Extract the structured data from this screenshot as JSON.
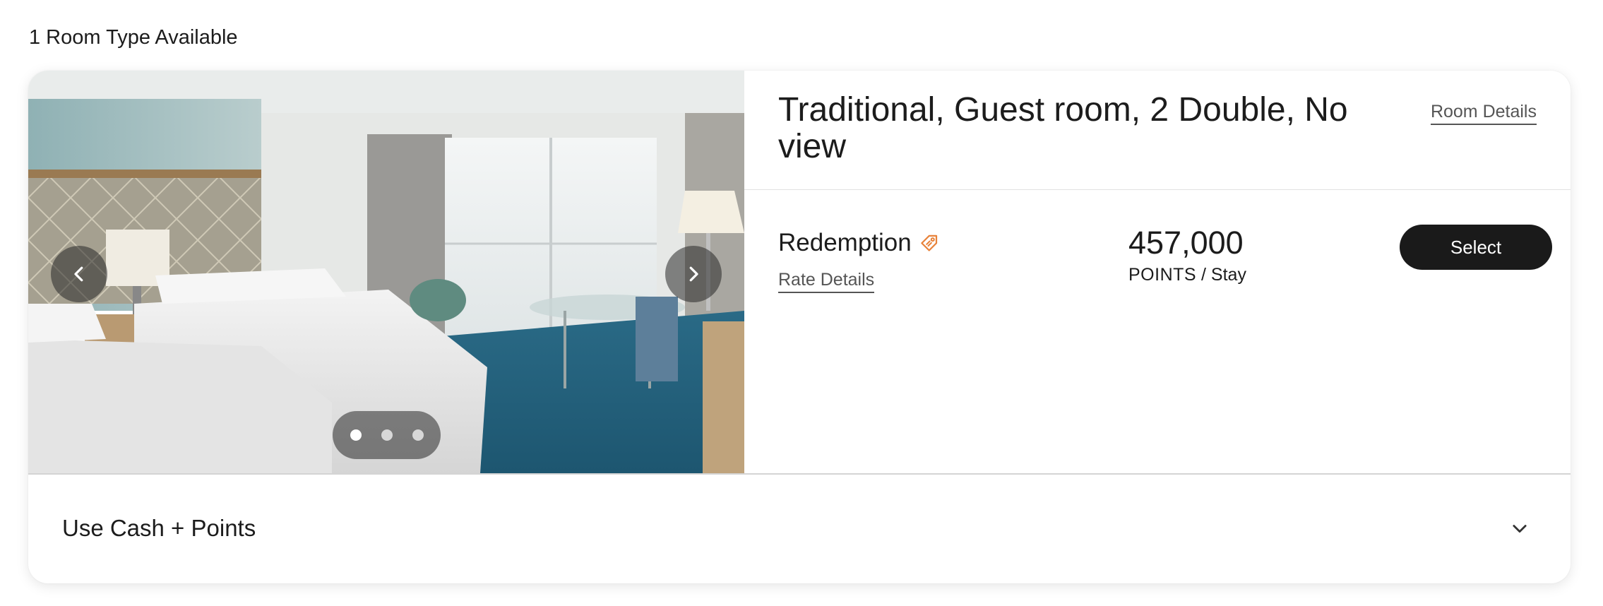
{
  "header": {
    "rooms_available": "1 Room Type Available"
  },
  "room": {
    "title": "Traditional, Guest room, 2 Double, No view",
    "details_link": "Room Details",
    "photo": {
      "icon": "room-photo",
      "slide_count": 3,
      "active_slide": 1
    }
  },
  "rate": {
    "name": "Redemption",
    "tag_icon": "price-tag-icon",
    "tag_icon_color": "#e8823a",
    "details_link": "Rate Details",
    "points": "457,000",
    "points_unit": "POINTS",
    "points_per": "/ Stay",
    "select_label": "Select"
  },
  "expander": {
    "label": "Use Cash + Points",
    "icon": "chevron-down-icon"
  },
  "colors": {
    "button_bg": "#1a1a1a",
    "link_text": "#555555",
    "accent_tag": "#e8823a"
  }
}
